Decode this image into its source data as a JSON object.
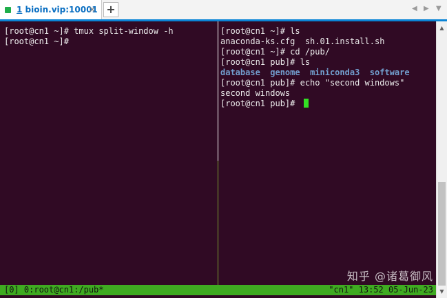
{
  "tab": {
    "index": "1",
    "title": "bioin.vip:10001",
    "close_glyph": "✕",
    "status_color": "#1fae4a"
  },
  "tab_controls": {
    "add_glyph": "+",
    "prev_glyph": "◀",
    "next_glyph": "▶",
    "menu_glyph": "▼"
  },
  "scrollbar": {
    "up_glyph": "▲",
    "down_glyph": "▼"
  },
  "left_pane": {
    "lines": [
      "[root@cn1 ~]# tmux split-window -h",
      "[root@cn1 ~]# "
    ]
  },
  "right_pane": {
    "lines": [
      "[root@cn1 ~]# ls",
      "anaconda-ks.cfg  sh.01.install.sh",
      "[root@cn1 ~]# cd /pub/",
      "[root@cn1 pub]# ls",
      "",
      "[root@cn1 pub]# echo \"second windows\"",
      "second windows",
      "[root@cn1 pub]# "
    ],
    "dirs": [
      "database",
      "genome",
      "miniconda3",
      "software"
    ]
  },
  "status_bar": {
    "left": "[0] 0:root@cn1:/pub*",
    "right": "\"cn1\" 13:52 05-Jun-23"
  },
  "watermark": "知乎 @诸葛御风",
  "colors": {
    "terminal_bg": "#300a24",
    "status_bar_bg": "#3faa21",
    "directory": "#729fcf",
    "cursor": "#33e023",
    "tab_accent": "#0a84d6"
  }
}
